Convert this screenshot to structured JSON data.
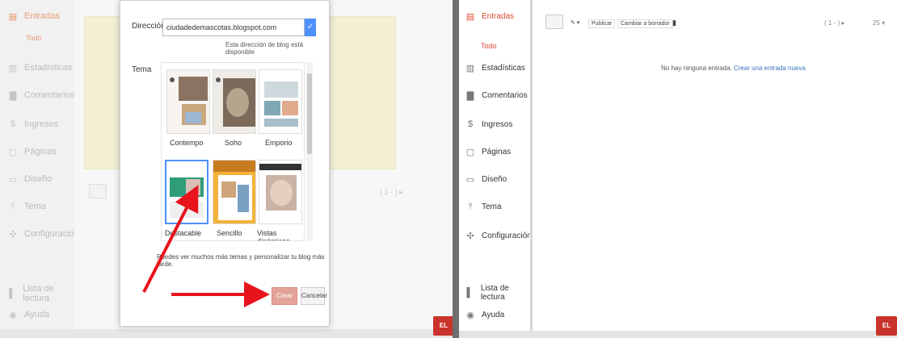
{
  "left_sidebar": {
    "items": [
      {
        "label": "Entradas",
        "icon": "document-icon"
      },
      {
        "label": "Todo",
        "icon": ""
      },
      {
        "label": "Estadísticas",
        "icon": "chart-icon"
      },
      {
        "label": "Comentarios",
        "icon": "comment-icon"
      },
      {
        "label": "Ingresos",
        "icon": "dollar-icon"
      },
      {
        "label": "Páginas",
        "icon": "page-icon"
      },
      {
        "label": "Diseño",
        "icon": "layout-icon"
      },
      {
        "label": "Tema",
        "icon": "brush-icon"
      },
      {
        "label": "Configuración",
        "icon": "gear-icon"
      },
      {
        "label": "Lista de lectura",
        "icon": "list-icon"
      },
      {
        "label": "Ayuda",
        "icon": "help-icon"
      }
    ]
  },
  "dialog": {
    "address_label": "Dirección",
    "address_value": "ciudadedemascotas.blogspot.com",
    "address_available": "Esta dirección de blog está disponible",
    "theme_label": "Tema",
    "themes": [
      {
        "name": "Contempo"
      },
      {
        "name": "Soho"
      },
      {
        "name": "Emporio"
      },
      {
        "name": "Destacable"
      },
      {
        "name": "Sencillo"
      },
      {
        "name": "Vistas dinámicas"
      }
    ],
    "more_themes_text": "Puedes ver muchos más temas y personalizar tu blog más tarde.",
    "create_label": "Crear blog",
    "cancel_label": "Cancelar"
  },
  "right_sidebar": {
    "items": [
      {
        "label": "Entradas",
        "icon": "document-icon"
      },
      {
        "label": "Todo",
        "icon": ""
      },
      {
        "label": "Estadísticas",
        "icon": "chart-icon"
      },
      {
        "label": "Comentarios",
        "icon": "comment-icon"
      },
      {
        "label": "Ingresos",
        "icon": "dollar-icon"
      },
      {
        "label": "Páginas",
        "icon": "page-icon"
      },
      {
        "label": "Diseño",
        "icon": "layout-icon"
      },
      {
        "label": "Tema",
        "icon": "brush-icon"
      },
      {
        "label": "Configuración",
        "icon": "gear-icon"
      },
      {
        "label": "Lista de lectura",
        "icon": "list-icon"
      },
      {
        "label": "Ayuda",
        "icon": "help-icon"
      }
    ]
  },
  "toolbar": {
    "publish_label": "Publicar",
    "draft_label": "Cambiar a borrador",
    "pager": "( 1 - ) ▸"
  },
  "main": {
    "empty_text": "No hay ninguna entrada.",
    "create_link": "Crear una entrada nueva"
  },
  "badge": {
    "text": "EL"
  },
  "colors": {
    "accent": "#dd4b39",
    "blue": "#4d90fe",
    "arrow": "#e8141c"
  }
}
